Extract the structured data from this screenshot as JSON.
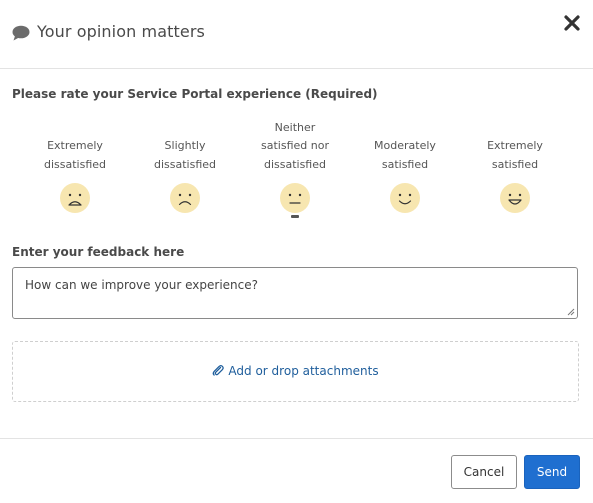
{
  "dialog": {
    "title": "Your opinion matters",
    "close_icon": "close-icon",
    "title_icon": "chat-bubble-icon"
  },
  "rating": {
    "label": "Please rate your Service Portal experience (Required)",
    "options": [
      {
        "line1": "Extremely",
        "line2": "dissatisfied",
        "line3": "",
        "icon": "very-sad-face-icon"
      },
      {
        "line1": "Slightly",
        "line2": "dissatisfied",
        "line3": "",
        "icon": "sad-face-icon"
      },
      {
        "line1": "Neither",
        "line2": "satisfied nor",
        "line3": "dissatisfied",
        "icon": "neutral-face-icon"
      },
      {
        "line1": "Moderately",
        "line2": "satisfied",
        "line3": "",
        "icon": "smile-face-icon"
      },
      {
        "line1": "Extremely",
        "line2": "satisfied",
        "line3": "",
        "icon": "big-smile-face-icon"
      }
    ],
    "focused_index": 2
  },
  "feedback": {
    "label": "Enter your feedback here",
    "placeholder": "How can we improve your experience?"
  },
  "attachments": {
    "link_label": "Add or drop attachments",
    "icon": "paperclip-icon"
  },
  "footer": {
    "cancel_label": "Cancel",
    "send_label": "Send"
  },
  "colors": {
    "face_fill": "#f7e6b0",
    "link": "#1f5e9c",
    "primary_button": "#1f6fd0"
  }
}
